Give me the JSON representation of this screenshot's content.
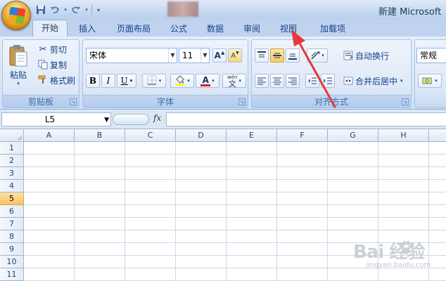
{
  "window": {
    "title": "新建 Microsoft"
  },
  "tabs": [
    "开始",
    "插入",
    "页面布局",
    "公式",
    "数据",
    "审阅",
    "视图",
    "加载项"
  ],
  "active_tab": "开始",
  "clipboard": {
    "paste_label": "粘贴",
    "cut_label": "剪切",
    "copy_label": "复制",
    "format_painter_label": "格式刷",
    "group_label": "剪贴板"
  },
  "font": {
    "font_name": "宋体",
    "font_size": "11",
    "grow_label": "A",
    "shrink_label": "A",
    "bold": "B",
    "italic": "I",
    "underline": "U",
    "font_color_label": "A",
    "phonetic_label": "wén",
    "phonetic_char": "文",
    "group_label": "字体"
  },
  "alignment": {
    "wrap_text_label": "自动换行",
    "merge_center_label": "合并后居中",
    "group_label": "对齐方式"
  },
  "number": {
    "format": "常规"
  },
  "formula_bar": {
    "name_box": "L5",
    "fx_label": "fx",
    "formula": ""
  },
  "grid": {
    "columns": [
      "A",
      "B",
      "C",
      "D",
      "E",
      "F",
      "G",
      "H"
    ],
    "rows": [
      "1",
      "2",
      "3",
      "4",
      "5",
      "6",
      "7",
      "8",
      "9",
      "10",
      "11"
    ],
    "selected_row": "5"
  },
  "watermark": {
    "main": "Bai  经验",
    "url": "jingyan.baidu.com"
  },
  "colors": {
    "ribbon_bg": "#dae6f6",
    "tab_text": "#15428b",
    "selected_row_header": "#f7c26a",
    "annotation_arrow": "#e53935"
  }
}
